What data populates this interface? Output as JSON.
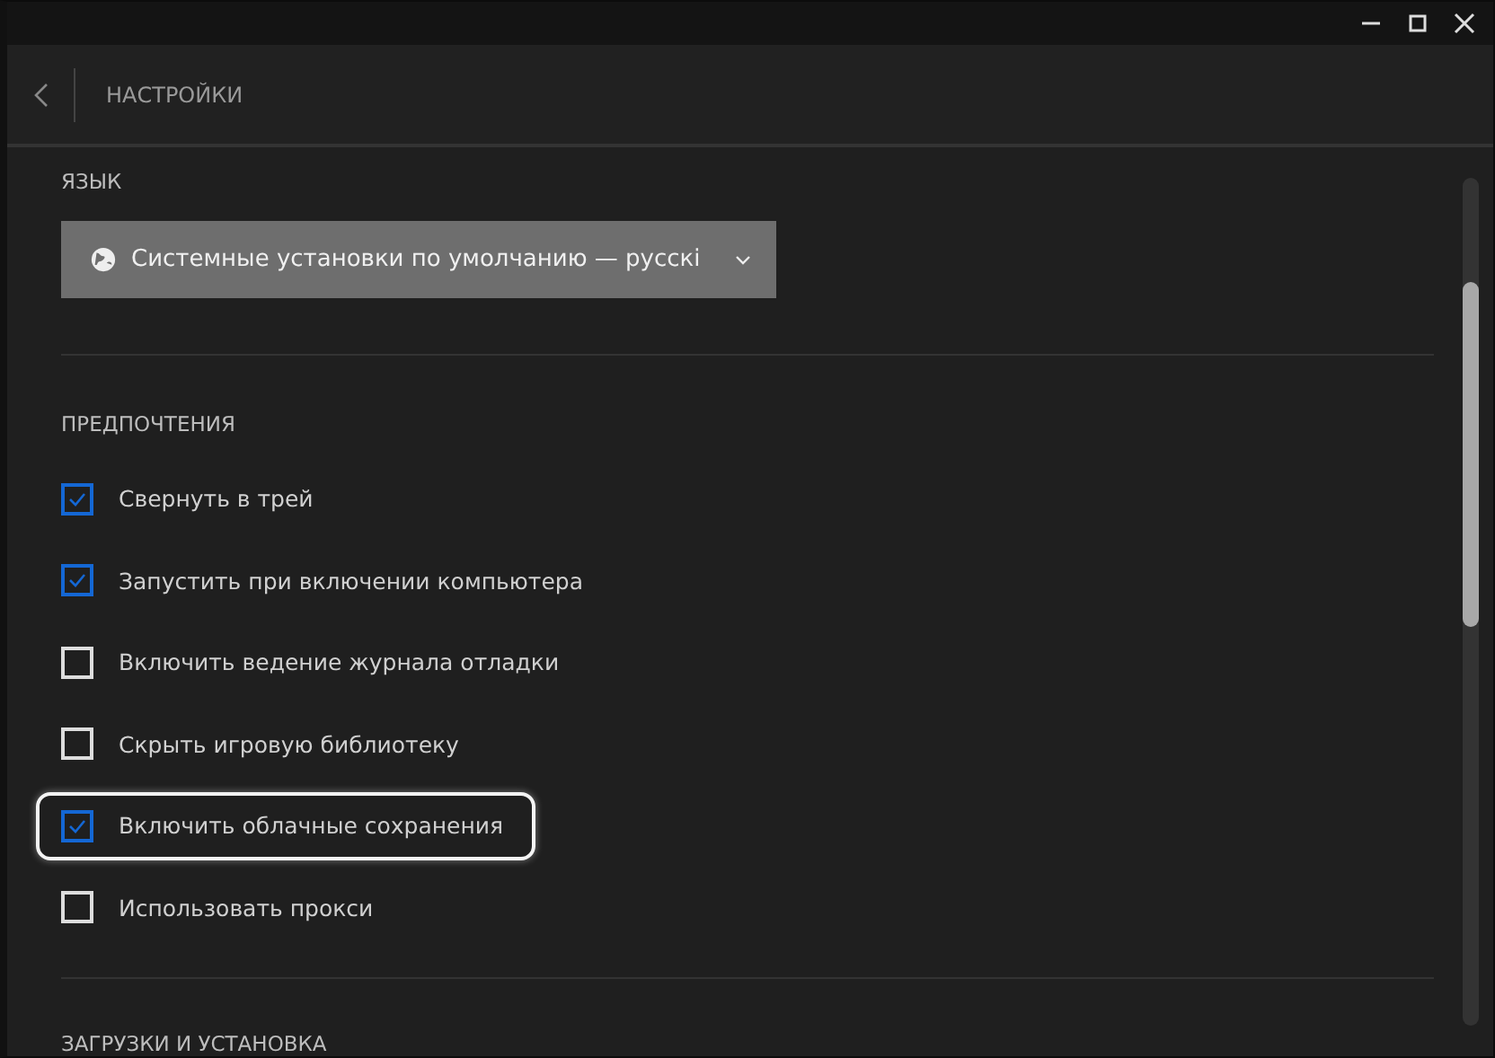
{
  "header": {
    "title": "НАСТРОЙКИ"
  },
  "language": {
    "heading": "ЯЗЫК",
    "value": "Системные установки по умолчанию — русскі"
  },
  "preferences": {
    "heading": "ПРЕДПОЧТЕНИЯ",
    "items": [
      {
        "label": "Свернуть в трей",
        "checked": true,
        "highlighted": false
      },
      {
        "label": "Запустить при включении компьютера",
        "checked": true,
        "highlighted": false
      },
      {
        "label": "Включить ведение журнала отладки",
        "checked": false,
        "highlighted": false
      },
      {
        "label": "Скрыть игровую библиотеку",
        "checked": false,
        "highlighted": false
      },
      {
        "label": "Включить облачные сохранения",
        "checked": true,
        "highlighted": true
      },
      {
        "label": "Использовать прокси",
        "checked": false,
        "highlighted": false
      }
    ]
  },
  "downloads": {
    "heading": "ЗАГРУЗКИ И УСТАНОВКА"
  }
}
